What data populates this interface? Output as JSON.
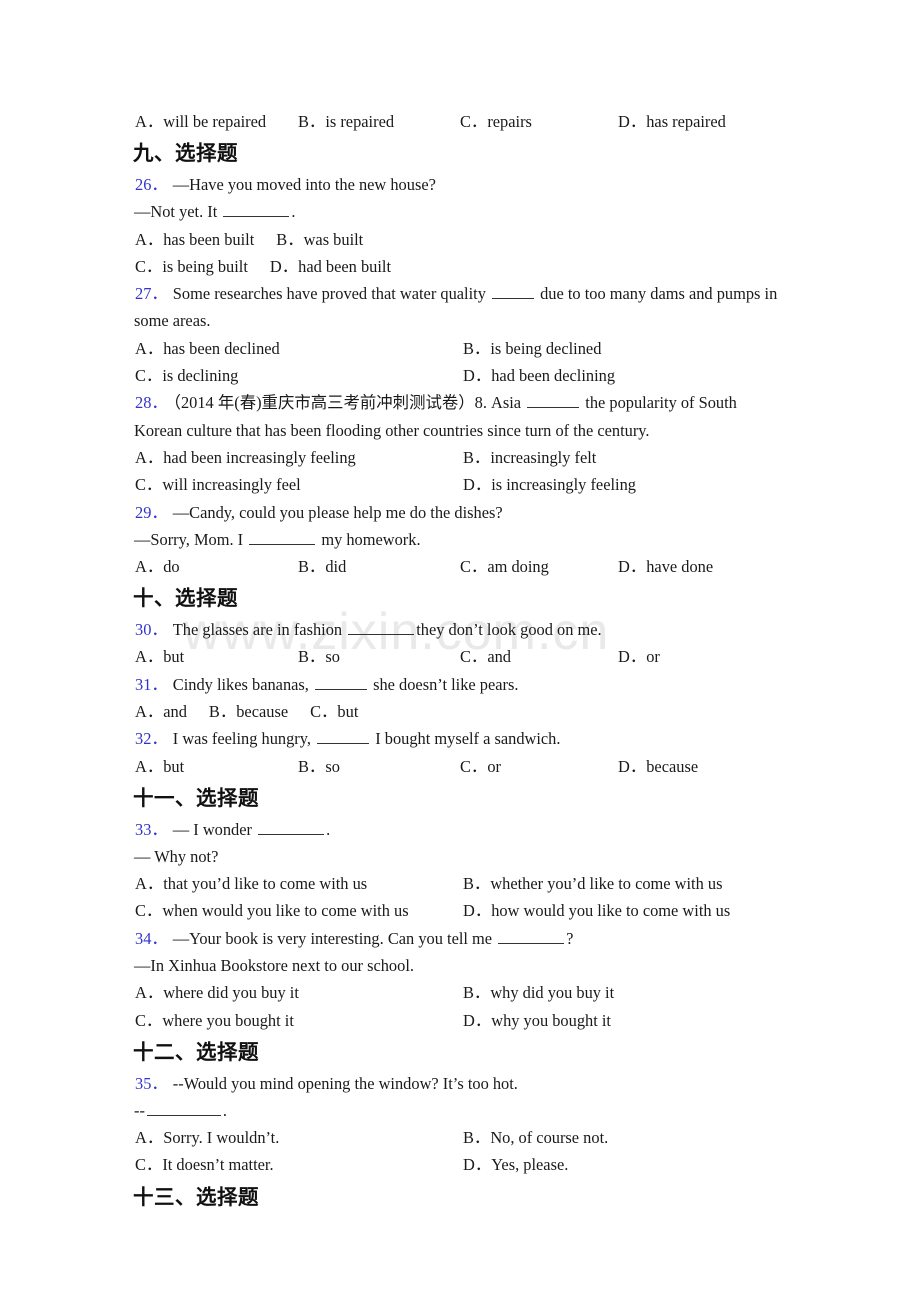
{
  "document": {
    "watermark": "www.zixin.com.cn",
    "accent_number_color": "#3333cc",
    "text_color": "#1a1a1a"
  },
  "top_orphan_options": {
    "a": "A．will be repaired",
    "b": "B．is repaired",
    "c": "C．repairs",
    "d": "D．has repaired"
  },
  "sections": [
    {
      "heading": "九、选择题"
    },
    {
      "heading": "十、选择题"
    },
    {
      "heading": "十一、选择题"
    },
    {
      "heading": "十二、选择题"
    },
    {
      "heading": "十三、选择题"
    }
  ],
  "questions": {
    "q26": {
      "num": "26．",
      "line1": "—Have you moved into the new house?",
      "line2_pre": "—Not yet. It ",
      "line2_post": ".",
      "a": "A．has been built",
      "b": "B．was built",
      "c": "C．is being built",
      "d": "D．had been built"
    },
    "q27": {
      "num": "27．",
      "line1_pre": "Some researches have proved that water quality ",
      "line1_post": " due to too many dams and pumps in",
      "line2": "some areas.",
      "a": "A．has been declined",
      "b": "B．is being declined",
      "c": "C．is declining",
      "d": "D．had been declining"
    },
    "q28": {
      "num": "28．",
      "line1_pre": "（2014 年(春)重庆市高三考前冲刺测试卷）8. Asia ",
      "line1_post": " the popularity of South",
      "line2": "Korean culture that has been flooding other countries since turn of the century.",
      "a": "A．had been increasingly feeling",
      "b": "B．increasingly felt",
      "c": "C．will increasingly feel",
      "d": "D．is increasingly feeling"
    },
    "q29": {
      "num": "29．",
      "line1": "—Candy, could you please help me do the dishes?",
      "line2_pre": "—Sorry, Mom. I ",
      "line2_post": " my homework.",
      "a": "A．do",
      "b": "B．did",
      "c": "C．am doing",
      "d": "D．have done"
    },
    "q30": {
      "num": "30．",
      "line1_pre": "The glasses are in fashion ",
      "line1_post": "they don’t look good on me.",
      "a": "A．but",
      "b": "B．so",
      "c": "C．and",
      "d": "D．or"
    },
    "q31": {
      "num": "31．",
      "line1_pre": "Cindy likes bananas, ",
      "line1_post": " she doesn’t like pears.",
      "a": "A．and",
      "b": "B．because",
      "c": "C．but"
    },
    "q32": {
      "num": "32．",
      "line1_pre": "I was feeling hungry, ",
      "line1_post": " I bought myself a sandwich.",
      "a": "A．but",
      "b": "B．so",
      "c": "C．or",
      "d": "D．because"
    },
    "q33": {
      "num": "33．",
      "line1_pre": "— I wonder ",
      "line1_post": ".",
      "line2": "— Why not?",
      "a": "A．that you’d like to come with us",
      "b": "B．whether you’d like to come with us",
      "c": "C．when would you like to come with us",
      "d": "D．how would you like to come with us"
    },
    "q34": {
      "num": "34．",
      "line1_pre": "—Your book is very interesting. Can you tell me ",
      "line1_post": "?",
      "line2": "—In Xinhua Bookstore next to our school.",
      "a": "A．where did you buy it",
      "b": "B．why did you buy it",
      "c": "C．where you bought it",
      "d": "D．why you bought it"
    },
    "q35": {
      "num": "35．",
      "line1": "--Would you mind opening the window? It’s too hot.",
      "line2_pre": "--",
      "line2_post": ".",
      "a": "A．Sorry. I wouldn’t.",
      "b": "B．No, of course not.",
      "c": "C．It doesn’t matter.",
      "d": "D．Yes, please."
    }
  }
}
